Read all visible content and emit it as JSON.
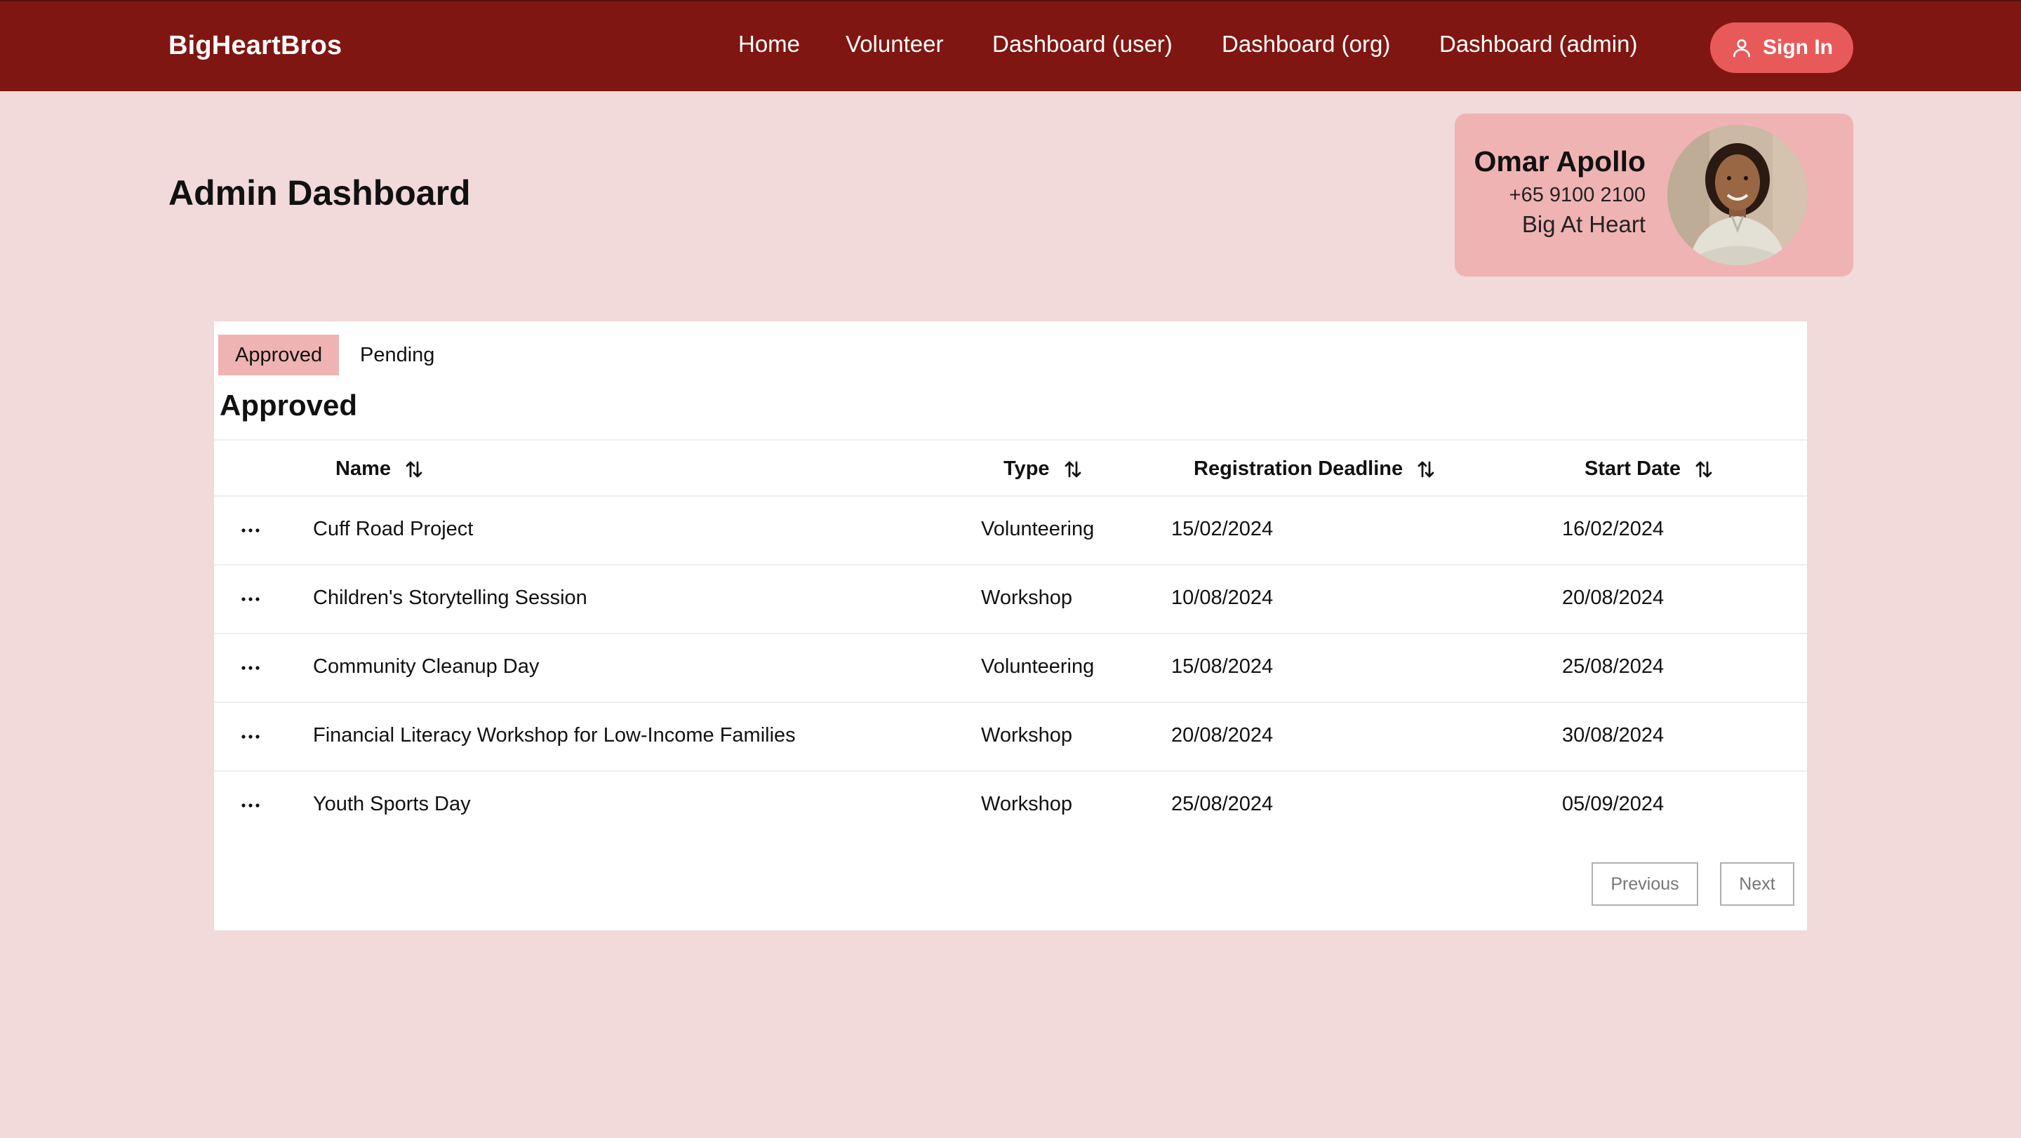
{
  "nav": {
    "brand": "BigHeartBros",
    "links": [
      "Home",
      "Volunteer",
      "Dashboard (user)",
      "Dashboard (org)",
      "Dashboard (admin)"
    ],
    "signin_label": "Sign In",
    "signin_icon": "user-icon",
    "bg_color": "#801611"
  },
  "header": {
    "title": "Admin Dashboard"
  },
  "profile": {
    "name": "Omar Apollo",
    "phone": "+65 9100 2100",
    "org": "Big At Heart"
  },
  "tabs": {
    "approved": "Approved",
    "pending": "Pending",
    "active": "Approved"
  },
  "section_title": "Approved",
  "table": {
    "columns": [
      "Name",
      "Type",
      "Registration Deadline",
      "Start Date"
    ],
    "rows": [
      {
        "name": "Cuff Road Project",
        "type": "Volunteering",
        "deadline": "15/02/2024",
        "start": "16/02/2024"
      },
      {
        "name": "Children's Storytelling Session",
        "type": "Workshop",
        "deadline": "10/08/2024",
        "start": "20/08/2024"
      },
      {
        "name": "Community Cleanup Day",
        "type": "Volunteering",
        "deadline": "15/08/2024",
        "start": "25/08/2024"
      },
      {
        "name": "Financial Literacy Workshop for Low-Income Families",
        "type": "Workshop",
        "deadline": "20/08/2024",
        "start": "30/08/2024"
      },
      {
        "name": "Youth Sports Day",
        "type": "Workshop",
        "deadline": "25/08/2024",
        "start": "05/09/2024"
      }
    ]
  },
  "pagination": {
    "previous": "Previous",
    "next": "Next"
  },
  "colors": {
    "accent": "#e85a5a",
    "card": "#f0b3b3",
    "background": "#f2d9da"
  }
}
